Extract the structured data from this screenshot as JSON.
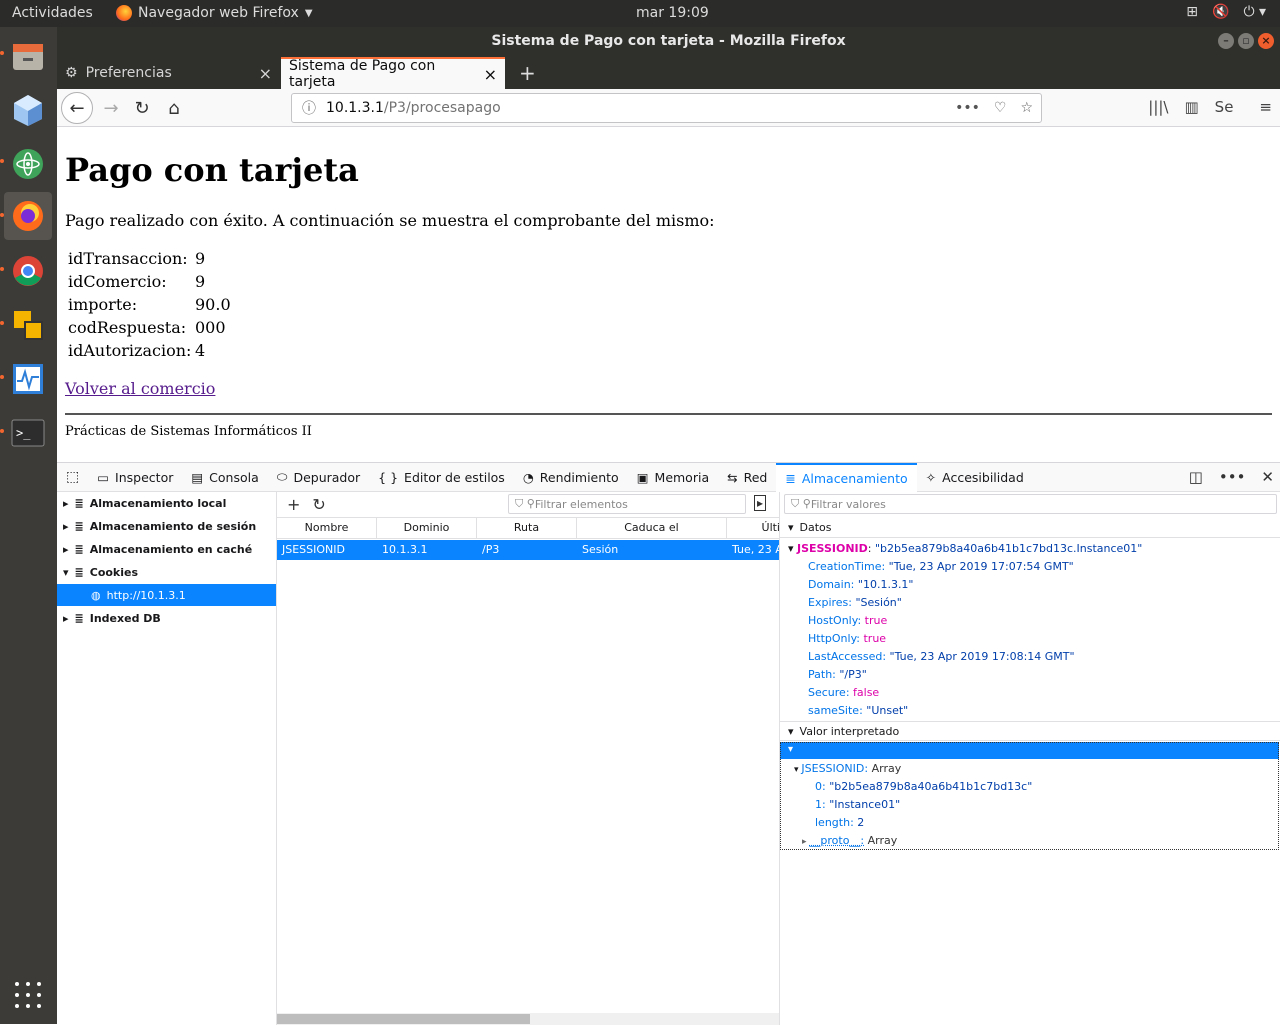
{
  "system": {
    "activities": "Actividades",
    "app_menu": "Navegador web Firefox",
    "clock": "mar 19:09"
  },
  "window": {
    "title": "Sistema de Pago con tarjeta - Mozilla Firefox"
  },
  "tabs": [
    {
      "label": "Preferencias"
    },
    {
      "label": "Sistema de Pago con tarjeta"
    }
  ],
  "url": {
    "host": "10.1.3.1",
    "path": "/P3/procesapago"
  },
  "page": {
    "title": "Pago con tarjeta",
    "message": "Pago realizado con éxito. A continuación se muestra el comprobante del mismo:",
    "receipt": [
      {
        "key": "idTransaccion:",
        "value": "9"
      },
      {
        "key": "idComercio:",
        "value": "9"
      },
      {
        "key": "importe:",
        "value": "90.0"
      },
      {
        "key": "codRespuesta:",
        "value": "000"
      },
      {
        "key": "idAutorizacion:",
        "value": "4"
      }
    ],
    "back_link": "Volver al comercio",
    "footer": "Prácticas de Sistemas Informáticos II"
  },
  "devtools": {
    "tabs": [
      "Inspector",
      "Consola",
      "Depurador",
      "Editor de estilos",
      "Rendimiento",
      "Memoria",
      "Red",
      "Almacenamiento",
      "Accesibilidad"
    ],
    "selected_tab": "Almacenamiento",
    "tree": [
      "Almacenamiento local",
      "Almacenamiento de sesión",
      "Almacenamiento en caché",
      "Cookies",
      "http://10.1.3.1",
      "Indexed DB"
    ],
    "filter_items": "Filtrar elementos",
    "filter_values": "Filtrar valores",
    "columns": [
      "Nombre",
      "Dominio",
      "Ruta",
      "Caduca el",
      "Últi"
    ],
    "row": [
      "JSESSIONID",
      "10.1.3.1",
      "/P3",
      "Sesión",
      "Tue, 23 A"
    ],
    "data_header": "Datos",
    "cookie_name": "JSESSIONID",
    "cookie_value": "\"b2b5ea879b8a40a6b41b1c7bd13c.Instance01\"",
    "props": [
      {
        "k": "CreationTime:",
        "v": "\"Tue, 23 Apr 2019 17:07:54 GMT\"",
        "t": "str"
      },
      {
        "k": "Domain:",
        "v": "\"10.1.3.1\"",
        "t": "str"
      },
      {
        "k": "Expires:",
        "v": "\"Sesión\"",
        "t": "str"
      },
      {
        "k": "HostOnly:",
        "v": "true",
        "t": "bool"
      },
      {
        "k": "HttpOnly:",
        "v": "true",
        "t": "bool"
      },
      {
        "k": "LastAccessed:",
        "v": "\"Tue, 23 Apr 2019 17:08:14 GMT\"",
        "t": "str"
      },
      {
        "k": "Path:",
        "v": "\"/P3\"",
        "t": "str"
      },
      {
        "k": "Secure:",
        "v": "false",
        "t": "bool"
      },
      {
        "k": "sameSite:",
        "v": "\"Unset\"",
        "t": "str"
      }
    ],
    "parsed_header": "Valor interpretado",
    "parsed": {
      "array_key": "JSESSIONID:",
      "array_type": "Array",
      "items": [
        {
          "k": "0:",
          "v": "\"b2b5ea879b8a40a6b41b1c7bd13c\""
        },
        {
          "k": "1:",
          "v": "\"Instance01\""
        }
      ],
      "length_key": "length:",
      "length_val": "2",
      "proto_key": "__proto__:",
      "proto_val": "Array"
    }
  }
}
